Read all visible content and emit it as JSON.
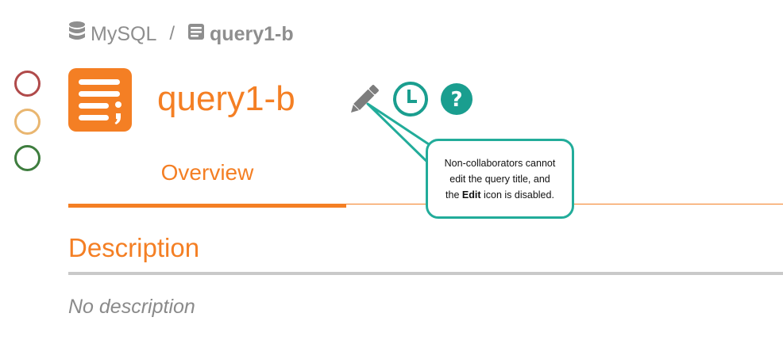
{
  "breadcrumb": {
    "database": "MySQL",
    "separator": "/",
    "query": "query1-b"
  },
  "header": {
    "title": "query1-b",
    "icons": [
      "query-icon",
      "pencil-icon",
      "clock-icon",
      "question-circle-icon"
    ]
  },
  "status_dots": {
    "colors": [
      "#b04a4a",
      "#e9b670",
      "#3e7d3e"
    ]
  },
  "tabs": [
    {
      "label": "Overview",
      "active": true
    }
  ],
  "section": {
    "heading": "Description",
    "empty_text": "No description"
  },
  "callout": {
    "line1": "Non-collaborators cannot",
    "line2": "edit the query title, and",
    "line3_pre": "the ",
    "line3_bold": "Edit",
    "line3_post": " icon is disabled."
  },
  "colors": {
    "accent": "#f47f24",
    "teal": "#1a9e8f",
    "callout_border": "#22ac9a",
    "muted": "#8e8e8e"
  }
}
